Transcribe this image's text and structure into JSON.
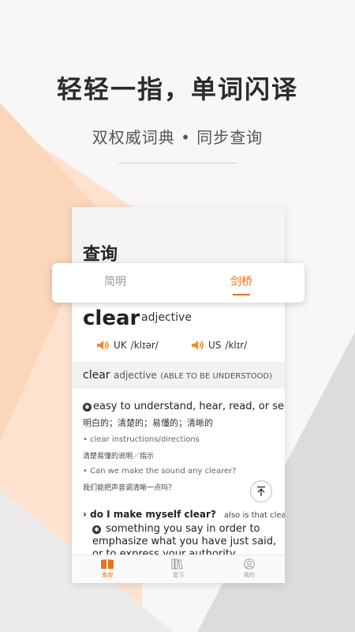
{
  "headline": "轻轻一指，单词闪译",
  "subline": "双权威词典 • 同步查询",
  "app": {
    "title": "查询",
    "tabs": [
      {
        "label": "简明",
        "active": false
      },
      {
        "label": "剑桥",
        "active": true
      }
    ],
    "word": "clear",
    "pos": "adjective",
    "pron": {
      "uk_label": "UK",
      "uk_ipa": "/klɪər/",
      "us_label": "US",
      "us_ipa": "/klɪr/"
    },
    "entry": {
      "word": "clear",
      "pos": "adjective",
      "guide": "(ABLE TO BE UNDERSTOOD)"
    },
    "definition": {
      "en": "easy to understand, hear, read, or see",
      "zh": "明白的；清楚的；易懂的；清晰的",
      "examples": [
        {
          "en": "• clear instructions/directions",
          "zh": "清楚易懂的说明／指示"
        },
        {
          "en": "• Can we make the sound any clearer?",
          "zh": "我们能把声音调清晰一点吗？"
        }
      ]
    },
    "idiom": {
      "phrase": "do I make myself clear?",
      "also": "also is that clear?",
      "def": "something you say in order to emphasize what you have just said, or to express your authority"
    },
    "nav": [
      {
        "label": "查询",
        "active": true
      },
      {
        "label": "复习",
        "active": false
      },
      {
        "label": "我的",
        "active": false
      }
    ]
  },
  "colors": {
    "accent": "#e8731a",
    "speaker": "#f08a1c"
  }
}
